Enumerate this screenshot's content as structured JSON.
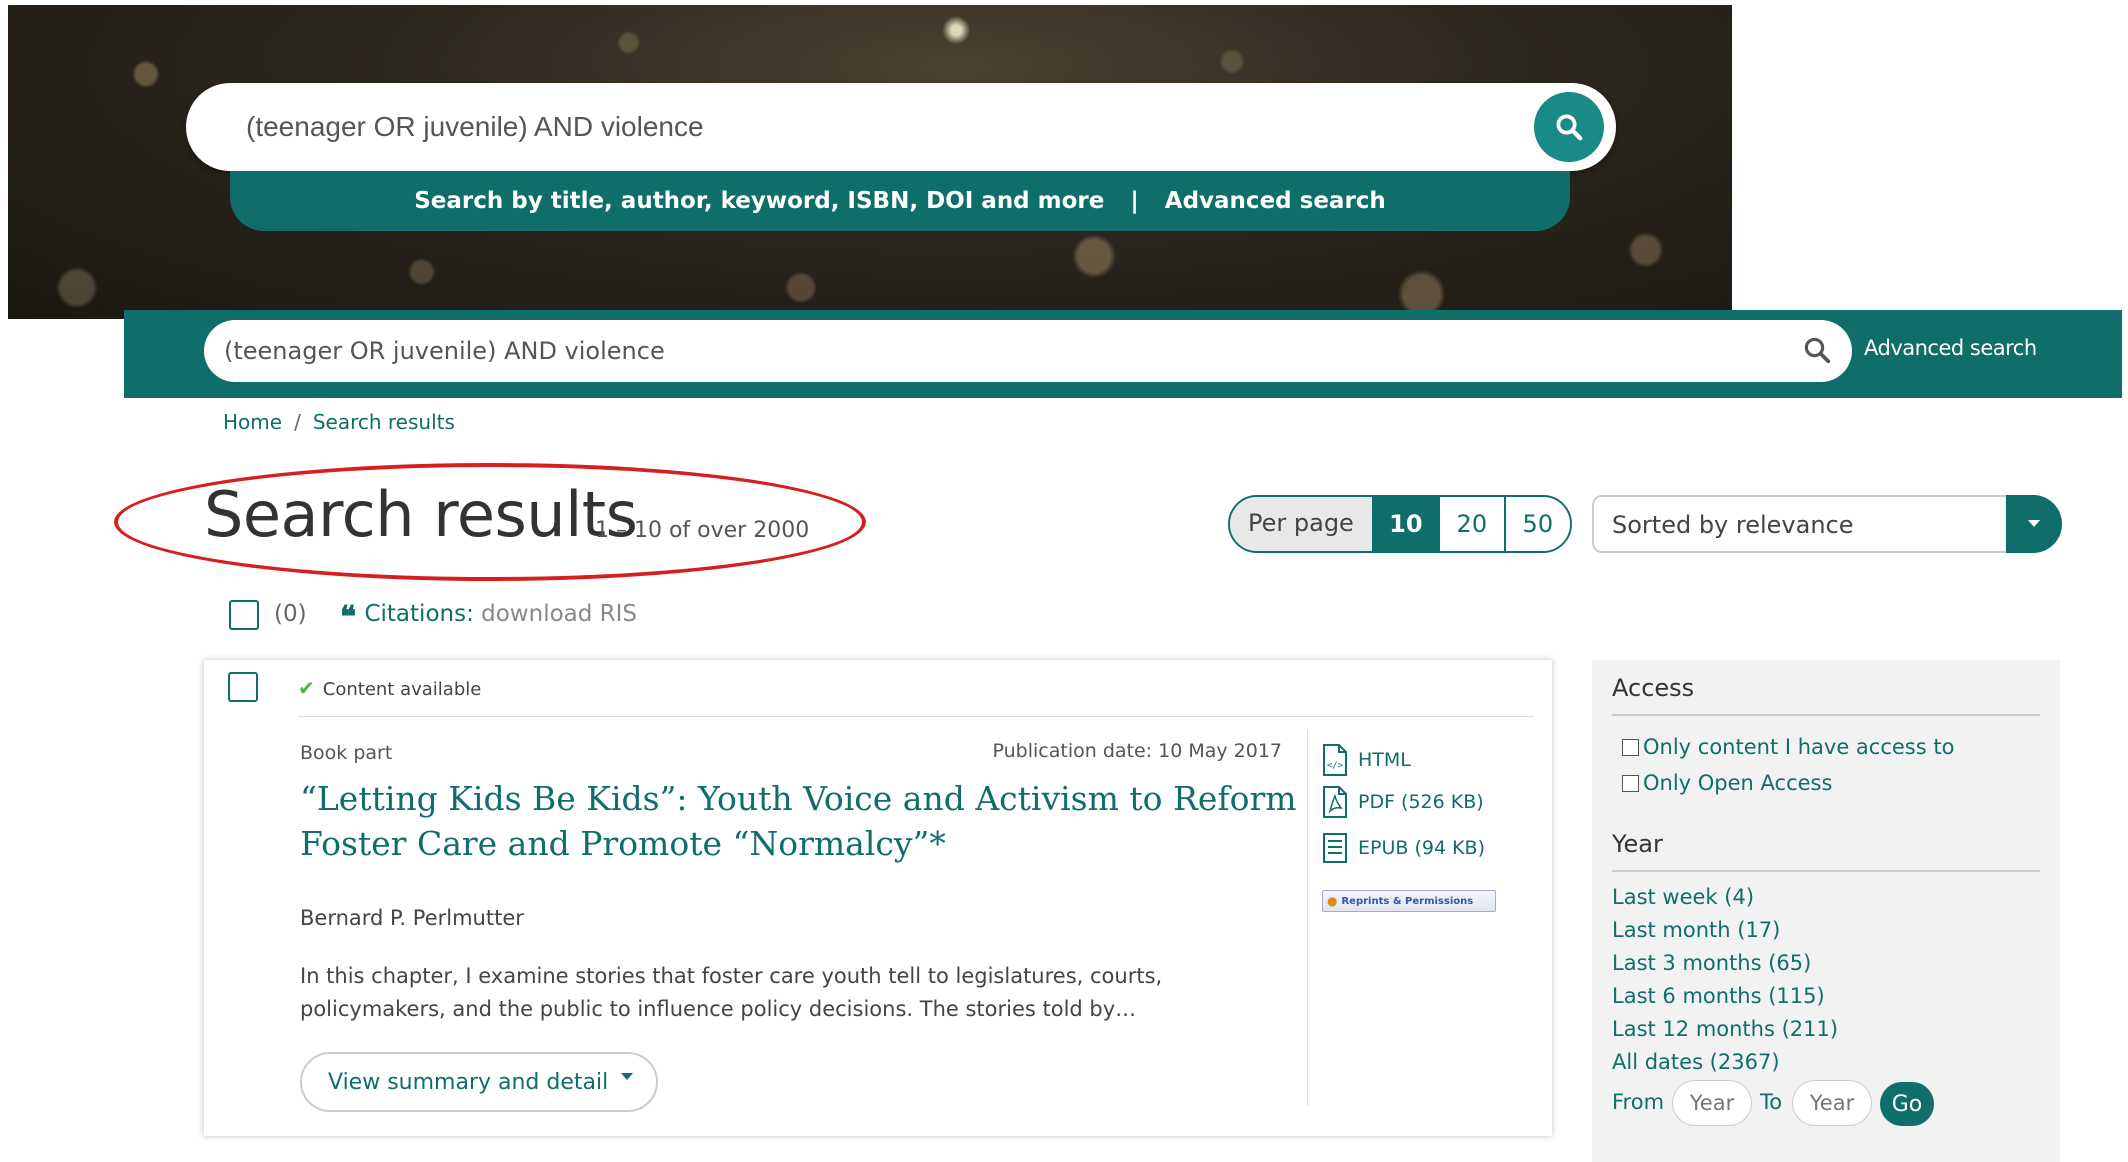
{
  "hero": {
    "search_value": "(teenager OR juvenile) AND violence",
    "subbar_text": "Search by title, author, keyword, ISBN, DOI and more",
    "separator": "|",
    "advanced_link": "Advanced search"
  },
  "header": {
    "search_value": "(teenager OR juvenile) AND violence",
    "advanced_link": "Advanced search"
  },
  "breadcrumb": {
    "home": "Home",
    "separator": "/",
    "current": "Search results"
  },
  "page": {
    "title": "Search results",
    "count": "1 – 10 of over 2000"
  },
  "per_page": {
    "label": "Per page",
    "options": [
      "10",
      "20",
      "50"
    ],
    "selected": "10"
  },
  "sort": {
    "label": "Sorted by relevance"
  },
  "selection": {
    "count": "(0)",
    "citations_label": "Citations:",
    "citations_action": "download RIS",
    "quote_glyph": "❝"
  },
  "result": {
    "availability": "Content available",
    "type": "Book part",
    "publication_date": "Publication date: 10 May 2017",
    "title": "“Letting Kids Be Kids”: Youth Voice and Activism to Reform Foster Care and Promote “Normalcy”*",
    "author": "Bernard P. Perlmutter",
    "abstract": "In this chapter, I examine stories that foster care youth tell to legislatures, courts, policymakers, and the public to influence policy decisions. The stories told by…",
    "view_button": "View summary and detail",
    "formats": [
      {
        "label": "HTML",
        "icon": "html-file-icon"
      },
      {
        "label": "PDF (526 KB)",
        "icon": "pdf-file-icon"
      },
      {
        "label": "EPUB (94 KB)",
        "icon": "epub-file-icon"
      }
    ],
    "reprints_label": "Reprints & Permissions"
  },
  "sidebar": {
    "access_heading": "Access",
    "access_options": [
      "Only content I have access to",
      "Only Open Access"
    ],
    "year_heading": "Year",
    "year_options": [
      "Last week (4)",
      "Last month (17)",
      "Last 3 months (65)",
      "Last 6 months (115)",
      "Last 12 months (211)",
      "All dates (2367)"
    ],
    "from_label": "From",
    "to_label": "To",
    "year_placeholder": "Year",
    "go_label": "Go"
  },
  "colors": {
    "brand_teal": "#0f6e6a",
    "accent_teal": "#1a8a86",
    "highlight_red": "#d62020",
    "check_green": "#4caf50"
  }
}
